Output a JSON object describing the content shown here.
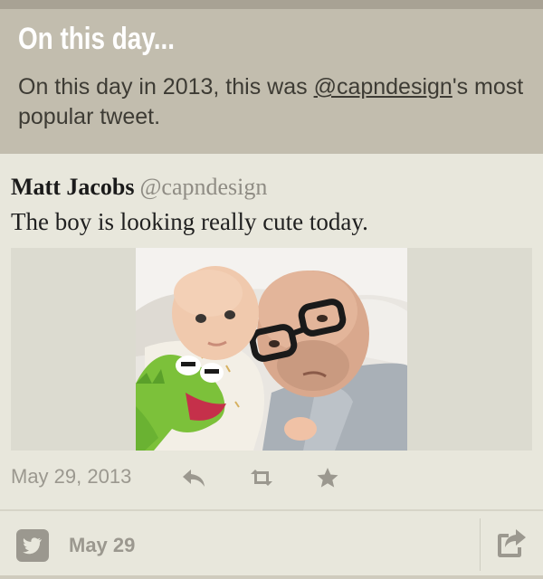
{
  "header": {
    "title": "On this day...",
    "text_prefix": "On this day in 2013, this was ",
    "handle": "@capndesign",
    "text_suffix": "'s most popular tweet."
  },
  "tweet": {
    "author_name": "Matt Jacobs",
    "author_handle": "@capndesign",
    "text": "The boy is looking really cute today.",
    "date": "May 29, 2013",
    "photo_icon": "photo-man-baby-kermit",
    "actions": [
      {
        "name": "reply",
        "icon": "reply-icon"
      },
      {
        "name": "retweet",
        "icon": "retweet-icon"
      },
      {
        "name": "favorite",
        "icon": "star-icon"
      }
    ]
  },
  "footer": {
    "source_icon": "twitter-icon",
    "date": "May 29",
    "share_icon": "share-icon"
  },
  "colors": {
    "header_bg": "#c2bdae",
    "body_bg": "#e8e7dc",
    "title_text": "#ffffff",
    "muted_text": "#9b988f"
  }
}
